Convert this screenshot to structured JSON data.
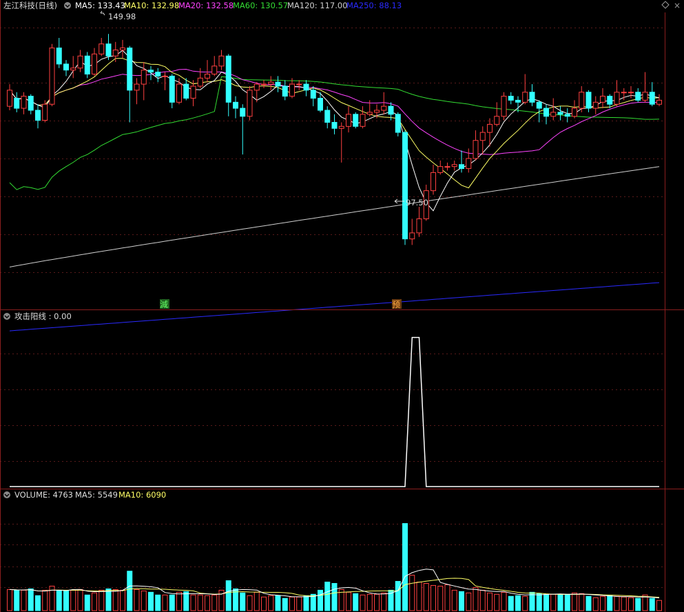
{
  "colors": {
    "bg": "#000000",
    "grid": "#5a1a1a",
    "separator": "#8a1e1e",
    "up": "#ff4040",
    "down": "#33ffff",
    "ma5": "#ffffff",
    "ma10": "#ffff66",
    "ma20": "#ff44ff",
    "ma60": "#33dd33",
    "ma120": "#cfcfcf",
    "ma250": "#2a2aff",
    "text": "#dddddd",
    "mark_green": "#33cc33",
    "mark_orange": "#ff9a33"
  },
  "header": {
    "title": "左江科技(日线)",
    "ma5": "MA5: 133.43",
    "ma10": "MA10: 132.98",
    "ma20": "MA20: 132.58",
    "ma60": "MA60: 130.57",
    "ma120": "MA120: 117.00",
    "ma250": "MA250: 88.13"
  },
  "annotations": {
    "high_label": "149.98",
    "low_label": "97.50",
    "mark_jian": "減",
    "mark_yu": "预"
  },
  "indicator": {
    "title": "攻击阳线 : 0.00"
  },
  "volume_header": {
    "volume": "VOLUME: 4763",
    "ma5": "MA5: 5549",
    "ma10": "MA10: 6090"
  },
  "chart_data": {
    "type": "candlestick",
    "ylim_price": [
      83,
      155
    ],
    "ylim_indicator": [
      0,
      1.1
    ],
    "ylim_volume": [
      0,
      16000
    ],
    "candles": [
      [
        132.0,
        136.0,
        137.5,
        131.0
      ],
      [
        134.0,
        131.5,
        135.5,
        130.5
      ],
      [
        131.5,
        134.5,
        135.5,
        130.0
      ],
      [
        134.5,
        131.0,
        135.0,
        130.0
      ],
      [
        131.0,
        128.5,
        132.5,
        126.5
      ],
      [
        128.5,
        132.5,
        133.5,
        128.0
      ],
      [
        132.5,
        146.5,
        147.5,
        132.0
      ],
      [
        146.5,
        142.5,
        149.0,
        141.5
      ],
      [
        142.5,
        141.0,
        143.5,
        139.5
      ],
      [
        141.0,
        141.5,
        144.5,
        139.0
      ],
      [
        141.5,
        144.5,
        146.0,
        140.5
      ],
      [
        144.5,
        140.0,
        145.5,
        139.0
      ],
      [
        140.0,
        145.0,
        146.5,
        139.5
      ],
      [
        145.0,
        147.5,
        149.0,
        144.5
      ],
      [
        147.5,
        144.5,
        149.98,
        143.5
      ],
      [
        144.5,
        146.0,
        148.0,
        143.0
      ],
      [
        146.0,
        146.5,
        148.5,
        144.0
      ],
      [
        146.5,
        136.0,
        147.0,
        128.0
      ],
      [
        136.0,
        137.5,
        139.0,
        132.5
      ],
      [
        137.5,
        141.0,
        143.0,
        133.5
      ],
      [
        141.0,
        140.5,
        142.0,
        138.5
      ],
      [
        140.5,
        139.5,
        141.5,
        138.0
      ],
      [
        139.5,
        139.5,
        140.5,
        136.0
      ],
      [
        139.5,
        133.0,
        140.0,
        131.5
      ],
      [
        133.0,
        137.5,
        139.0,
        132.5
      ],
      [
        137.5,
        134.0,
        139.0,
        133.5
      ],
      [
        134.0,
        137.0,
        138.5,
        132.0
      ],
      [
        137.0,
        139.0,
        141.5,
        136.5
      ],
      [
        139.0,
        140.0,
        143.5,
        138.0
      ],
      [
        140.0,
        142.0,
        144.5,
        139.5
      ],
      [
        142.0,
        144.5,
        146.0,
        141.0
      ],
      [
        144.5,
        133.0,
        145.0,
        129.5
      ],
      [
        133.0,
        131.5,
        134.5,
        129.0
      ],
      [
        131.5,
        129.5,
        132.5,
        120.0
      ],
      [
        129.5,
        136.0,
        137.0,
        128.5
      ],
      [
        136.0,
        137.5,
        138.0,
        133.0
      ],
      [
        137.5,
        137.5,
        138.5,
        136.5
      ],
      [
        137.5,
        138.0,
        139.5,
        136.0
      ],
      [
        138.0,
        137.0,
        139.5,
        135.5
      ],
      [
        137.0,
        134.5,
        138.5,
        133.5
      ],
      [
        134.5,
        137.5,
        139.0,
        134.0
      ],
      [
        137.5,
        137.5,
        138.5,
        136.0
      ],
      [
        137.5,
        136.0,
        138.5,
        134.5
      ],
      [
        136.0,
        134.0,
        137.0,
        132.0
      ],
      [
        134.0,
        131.0,
        135.5,
        130.5
      ],
      [
        131.0,
        128.0,
        132.0,
        126.5
      ],
      [
        128.0,
        126.5,
        130.0,
        125.0
      ],
      [
        126.5,
        127.0,
        128.0,
        118.0
      ],
      [
        127.0,
        130.0,
        132.0,
        125.5
      ],
      [
        130.0,
        127.0,
        130.5,
        126.5
      ],
      [
        127.0,
        130.0,
        132.0,
        126.5
      ],
      [
        130.0,
        130.5,
        133.5,
        129.5
      ],
      [
        130.5,
        131.0,
        132.5,
        129.0
      ],
      [
        131.0,
        132.0,
        135.5,
        130.0
      ],
      [
        132.0,
        130.0,
        133.0,
        128.5
      ],
      [
        130.0,
        125.5,
        130.5,
        124.5
      ],
      [
        125.5,
        99.0,
        126.0,
        97.5
      ],
      [
        99.0,
        100.5,
        104.0,
        97.5
      ],
      [
        100.5,
        104.0,
        107.0,
        99.5
      ],
      [
        104.0,
        111.0,
        112.5,
        103.5
      ],
      [
        111.0,
        115.5,
        117.5,
        110.0
      ],
      [
        115.5,
        117.0,
        118.5,
        115.0
      ],
      [
        117.0,
        117.0,
        118.0,
        116.0
      ],
      [
        117.0,
        117.5,
        118.5,
        116.0
      ],
      [
        117.5,
        116.5,
        121.0,
        115.5
      ],
      [
        116.5,
        119.0,
        121.5,
        115.5
      ],
      [
        119.0,
        123.5,
        126.0,
        118.5
      ],
      [
        123.5,
        125.5,
        127.0,
        120.0
      ],
      [
        125.5,
        127.5,
        129.0,
        122.0
      ],
      [
        127.5,
        129.5,
        133.0,
        127.0
      ],
      [
        129.5,
        134.5,
        135.5,
        128.5
      ],
      [
        134.5,
        133.5,
        135.5,
        132.5
      ],
      [
        133.5,
        133.0,
        134.5,
        130.5
      ],
      [
        133.0,
        135.5,
        140.0,
        132.5
      ],
      [
        135.5,
        133.0,
        137.5,
        132.0
      ],
      [
        133.0,
        131.5,
        133.5,
        128.0
      ],
      [
        131.5,
        129.5,
        132.5,
        127.5
      ],
      [
        129.5,
        130.5,
        134.0,
        128.5
      ],
      [
        130.5,
        130.0,
        132.0,
        128.5
      ],
      [
        130.0,
        129.5,
        131.5,
        128.0
      ],
      [
        129.5,
        131.5,
        133.5,
        129.0
      ],
      [
        131.5,
        135.5,
        137.0,
        130.5
      ],
      [
        135.5,
        131.5,
        136.0,
        130.5
      ],
      [
        131.5,
        133.0,
        134.5,
        130.0
      ],
      [
        133.0,
        134.5,
        136.5,
        131.5
      ],
      [
        134.5,
        132.5,
        135.0,
        131.5
      ],
      [
        132.5,
        135.5,
        138.5,
        132.0
      ],
      [
        135.5,
        135.5,
        136.5,
        133.5
      ],
      [
        135.5,
        135.5,
        137.0,
        134.0
      ],
      [
        135.5,
        133.5,
        136.5,
        133.0
      ],
      [
        133.5,
        135.5,
        140.5,
        133.0
      ],
      [
        135.5,
        132.5,
        138.0,
        132.0
      ],
      [
        132.5,
        133.5,
        135.0,
        132.0
      ]
    ],
    "volume": [
      3100,
      3000,
      3000,
      3200,
      2200,
      3000,
      3600,
      3000,
      2900,
      3000,
      3100,
      2300,
      2600,
      3000,
      3200,
      3100,
      3000,
      5800,
      3100,
      2900,
      2700,
      2300,
      2300,
      2300,
      2700,
      2800,
      2300,
      2300,
      2200,
      2300,
      3000,
      4400,
      3200,
      2600,
      2200,
      2700,
      2000,
      2200,
      2200,
      1800,
      2000,
      2000,
      2200,
      2400,
      3000,
      4200,
      4000,
      3100,
      2700,
      2500,
      2300,
      2400,
      2400,
      2600,
      3000,
      4300,
      12800,
      5200,
      4200,
      4000,
      3700,
      3600,
      3800,
      3000,
      2800,
      2600,
      3400,
      3000,
      2600,
      2400,
      2700,
      2100,
      2200,
      2100,
      2700,
      2500,
      2400,
      2400,
      2300,
      2400,
      2600,
      2500,
      2100,
      1900,
      2100,
      2200,
      2100,
      2000,
      1900,
      1800,
      2300,
      1800,
      1500
    ],
    "indicator_signal_index": 57,
    "indicator_signal_value": 1.0,
    "ma250": [
      88.13
    ],
    "ma120": [
      117.0
    ]
  }
}
